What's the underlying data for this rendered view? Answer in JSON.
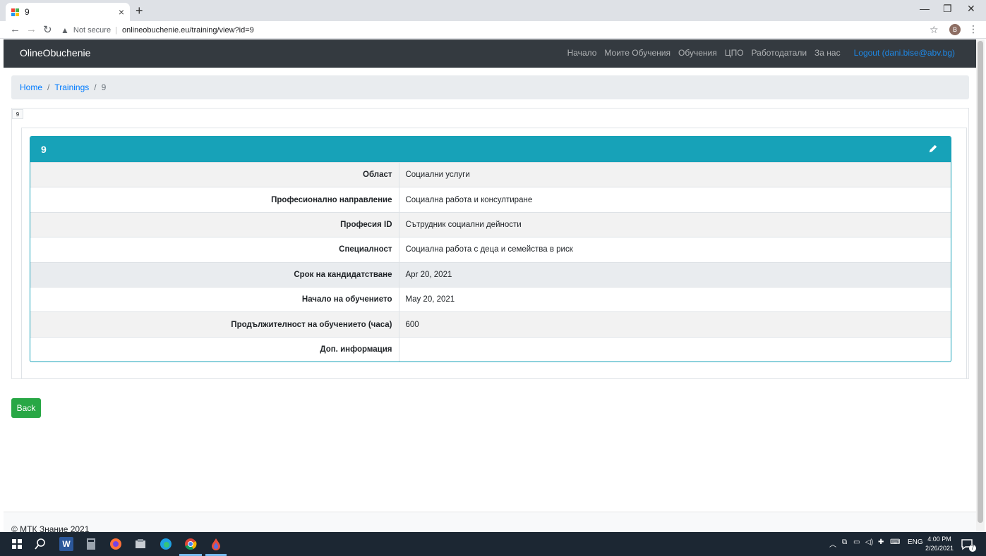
{
  "browser": {
    "tab_title": "9",
    "tab_close": "×",
    "new_tab": "+",
    "security_label": "Not secure",
    "url": "onlineobuchenie.eu/training/view?id=9",
    "profile_initial": "B",
    "window_minimize": "—",
    "window_restore": "❐",
    "window_close": "✕"
  },
  "navbar": {
    "brand": "OlineObuchenie",
    "links": [
      "Начало",
      "Моите Обучения",
      "Обучения",
      "ЦПО",
      "Работодатали",
      "За нас"
    ],
    "logout": "Logout (dani.bise@abv.bg)"
  },
  "breadcrumb": {
    "home": "Home",
    "trainings": "Trainings",
    "current": "9"
  },
  "id_tag": "9",
  "card": {
    "title": "9",
    "rows": [
      {
        "label": "Област",
        "value": "Социални услуги"
      },
      {
        "label": "Професионално направление",
        "value": "Социална работа и консултиране"
      },
      {
        "label": "Професия ID",
        "value": "Сътрудник социални дейности"
      },
      {
        "label": "Специалност",
        "value": "Социална работа с деца и семейства в риск"
      },
      {
        "label": "Срок на кандидатстване",
        "value": "Apr 20, 2021"
      },
      {
        "label": "Начало на обучението",
        "value": "May 20, 2021"
      },
      {
        "label": "Продължителност на обучението (часа)",
        "value": "600"
      },
      {
        "label": "Доп. информация",
        "value": ""
      }
    ]
  },
  "back_button": "Back",
  "footer": "© МТК Знание 2021",
  "taskbar": {
    "language": "ENG",
    "time": "4:00 PM",
    "date": "2/26/2021",
    "notification_count": "7",
    "word_icon": "W"
  },
  "colors": {
    "navbar_bg": "#343a40",
    "card_accent": "#17a2b8",
    "link": "#007bff",
    "success": "#28a745"
  }
}
